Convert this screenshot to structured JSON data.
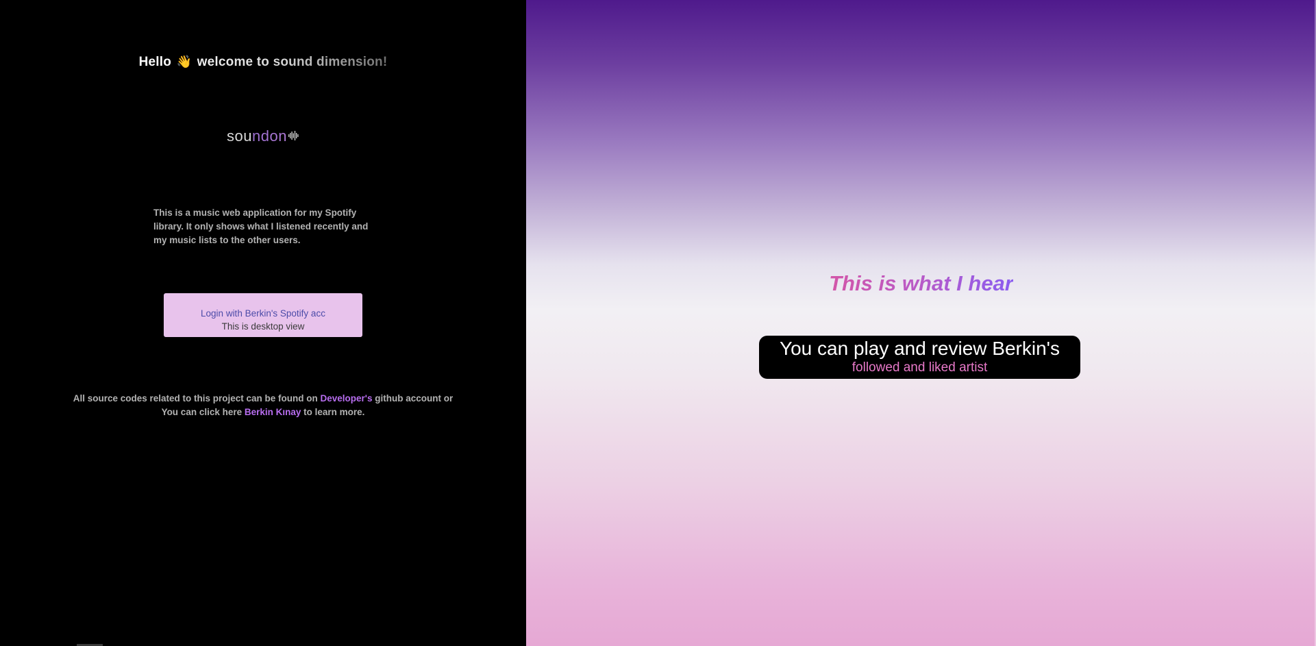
{
  "greeting": {
    "hello": "Hello",
    "wave_emoji": "👋",
    "welcome": "welcome to sound dimension!"
  },
  "logo": {
    "part_a": "sou",
    "part_b": "ndon",
    "icon": "soundwave-icon"
  },
  "description": "This is a music web application for my Spotify library. It only shows what I listened recently and my music lists to the other users.",
  "login_button": {
    "label": "Login with Berkin's Spotify acc",
    "sublabel": "This is desktop view"
  },
  "footer": {
    "line1_prefix": "All source codes related to this project can be found on ",
    "developer_link": "Developer's",
    "line1_suffix": " github account or",
    "line2_prefix": "You can click here ",
    "author_link": "Berkin Kınay",
    "line2_suffix": " to learn more."
  },
  "hero": {
    "headline": "This is what I hear",
    "info_main": "You can play and review Berkin's",
    "info_sub": "followed and liked artist"
  },
  "colors": {
    "accent_purple": "#b86ef0",
    "button_bg": "#e8c3ec",
    "headline_pink": "#d356a8",
    "subtext_pink": "#e879c9"
  }
}
